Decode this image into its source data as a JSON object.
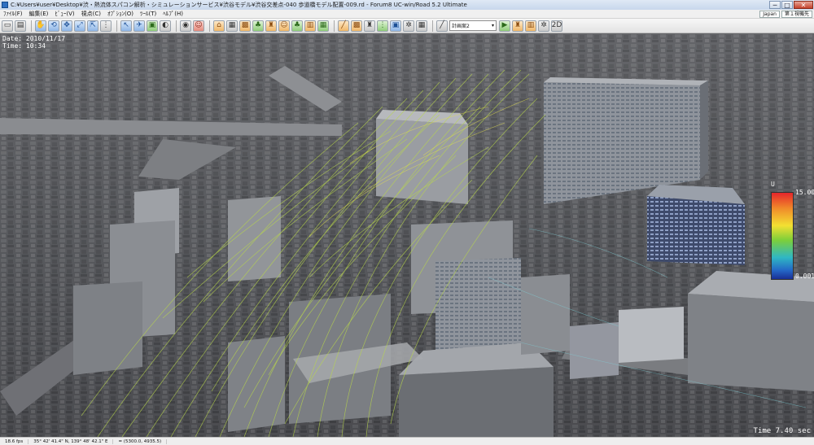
{
  "window": {
    "title": "C:¥Users¥user¥Desktop¥渋・熱流体スパコン解析・シミュレーションサービス¥渋谷モデル¥渋谷交差点-040 歩道橋モデル配置-009.rd - Forum8 UC-win/Road 5.2 Ultimate",
    "min_label": "─",
    "max_label": "□",
    "close_label": "✕"
  },
  "menu": {
    "items": [
      "ﾌｧｲﾙ(F)",
      "編集(E)",
      "ﾋﾞｭｰ(V)",
      "視点(C)",
      "ｵﾌﾟｼｮﾝ(O)",
      "ﾂｰﾙ(T)",
      "ﾍﾙﾌﾟ(H)"
    ],
    "language": "Japan",
    "display": "第１視機先"
  },
  "toolbar": {
    "plan_select": "計画案2",
    "plan_select_arrow": "▾",
    "icons": {
      "new": "▭",
      "open": "▤",
      "hand": "✋",
      "rotate": "⟲",
      "move": "✥",
      "zoom": "⤢",
      "walk": "⇱",
      "road": "⋮",
      "cursor": "↖",
      "fly": "✈",
      "car": "▣",
      "signal": "◐",
      "person": "☺",
      "building": "⌂",
      "tree": "♣",
      "model": "▦",
      "camera": "◉",
      "ruler": "╱",
      "texture": "▩",
      "play": "▶",
      "scene": "♜",
      "chart": "▥",
      "settings": "✲",
      "help": "?",
      "zoom2d": "2D"
    }
  },
  "viewport": {
    "date_text": "Date: 2010/11/17",
    "time_text": "Time: 10:34",
    "sim_time": "Time   7.40 sec",
    "legend": {
      "unit": "U",
      "max": "15.00",
      "min": "0.001"
    }
  },
  "status": {
    "fps": "18.6 fps",
    "lat": "35°  42' 41.4\" N, 139°  48' 42.1\" E",
    "pos": "= (5300.0, 4935.5)"
  }
}
